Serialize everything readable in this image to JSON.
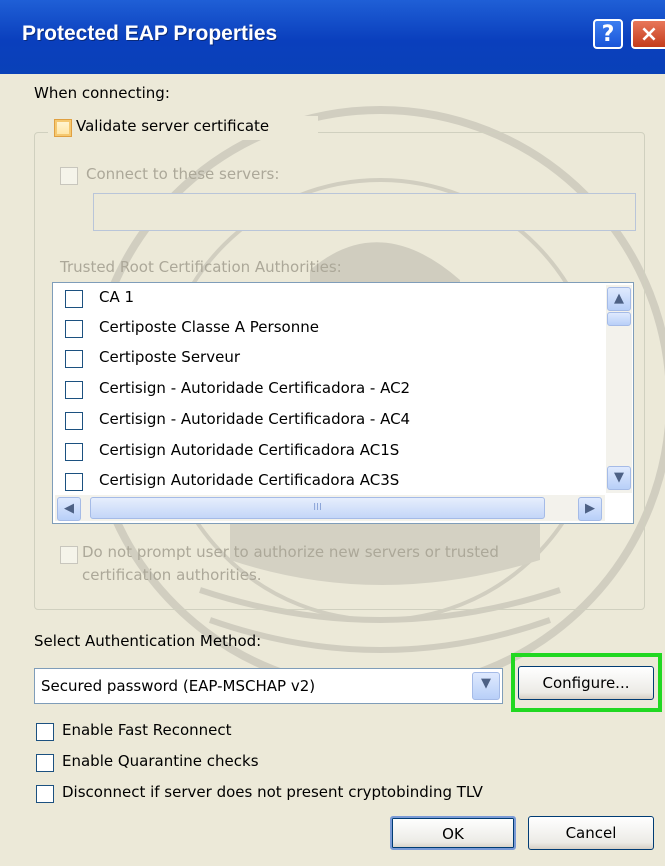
{
  "window": {
    "title": "Protected EAP Properties",
    "help_glyph": "?",
    "close_glyph": "×"
  },
  "connecting": {
    "label": "When connecting:",
    "validate_label": "Validate server certificate",
    "connect_servers_label": "Connect to these servers:",
    "servers_value": "",
    "trusted_label": "Trusted Root Certification Authorities:",
    "ca_list": [
      {
        "name": "CA 1",
        "checked": false
      },
      {
        "name": "Certiposte Classe A Personne",
        "checked": false
      },
      {
        "name": "Certiposte Serveur",
        "checked": false
      },
      {
        "name": "Certisign - Autoridade Certificadora - AC2",
        "checked": false
      },
      {
        "name": "Certisign - Autoridade Certificadora - AC4",
        "checked": false
      },
      {
        "name": "Certisign Autoridade Certificadora AC1S",
        "checked": false
      },
      {
        "name": "Certisign Autoridade Certificadora AC3S",
        "checked": false
      }
    ],
    "hscroll_grip": "III",
    "prompt_line1": "Do not prompt user to authorize new servers or trusted",
    "prompt_line2": "certification authorities."
  },
  "auth": {
    "label": "Select Authentication Method:",
    "selected": "Secured password (EAP-MSCHAP v2)",
    "configure_label": "Configure..."
  },
  "options": {
    "fast_reconnect": "Enable Fast Reconnect",
    "quarantine": "Enable Quarantine checks",
    "cryptobinding": "Disconnect if server does not present cryptobinding TLV"
  },
  "buttons": {
    "ok": "OK",
    "cancel": "Cancel"
  },
  "colors": {
    "titlebar": "#0a3fbd",
    "dialog_bg": "#ece9d8",
    "highlight": "#21d821"
  }
}
